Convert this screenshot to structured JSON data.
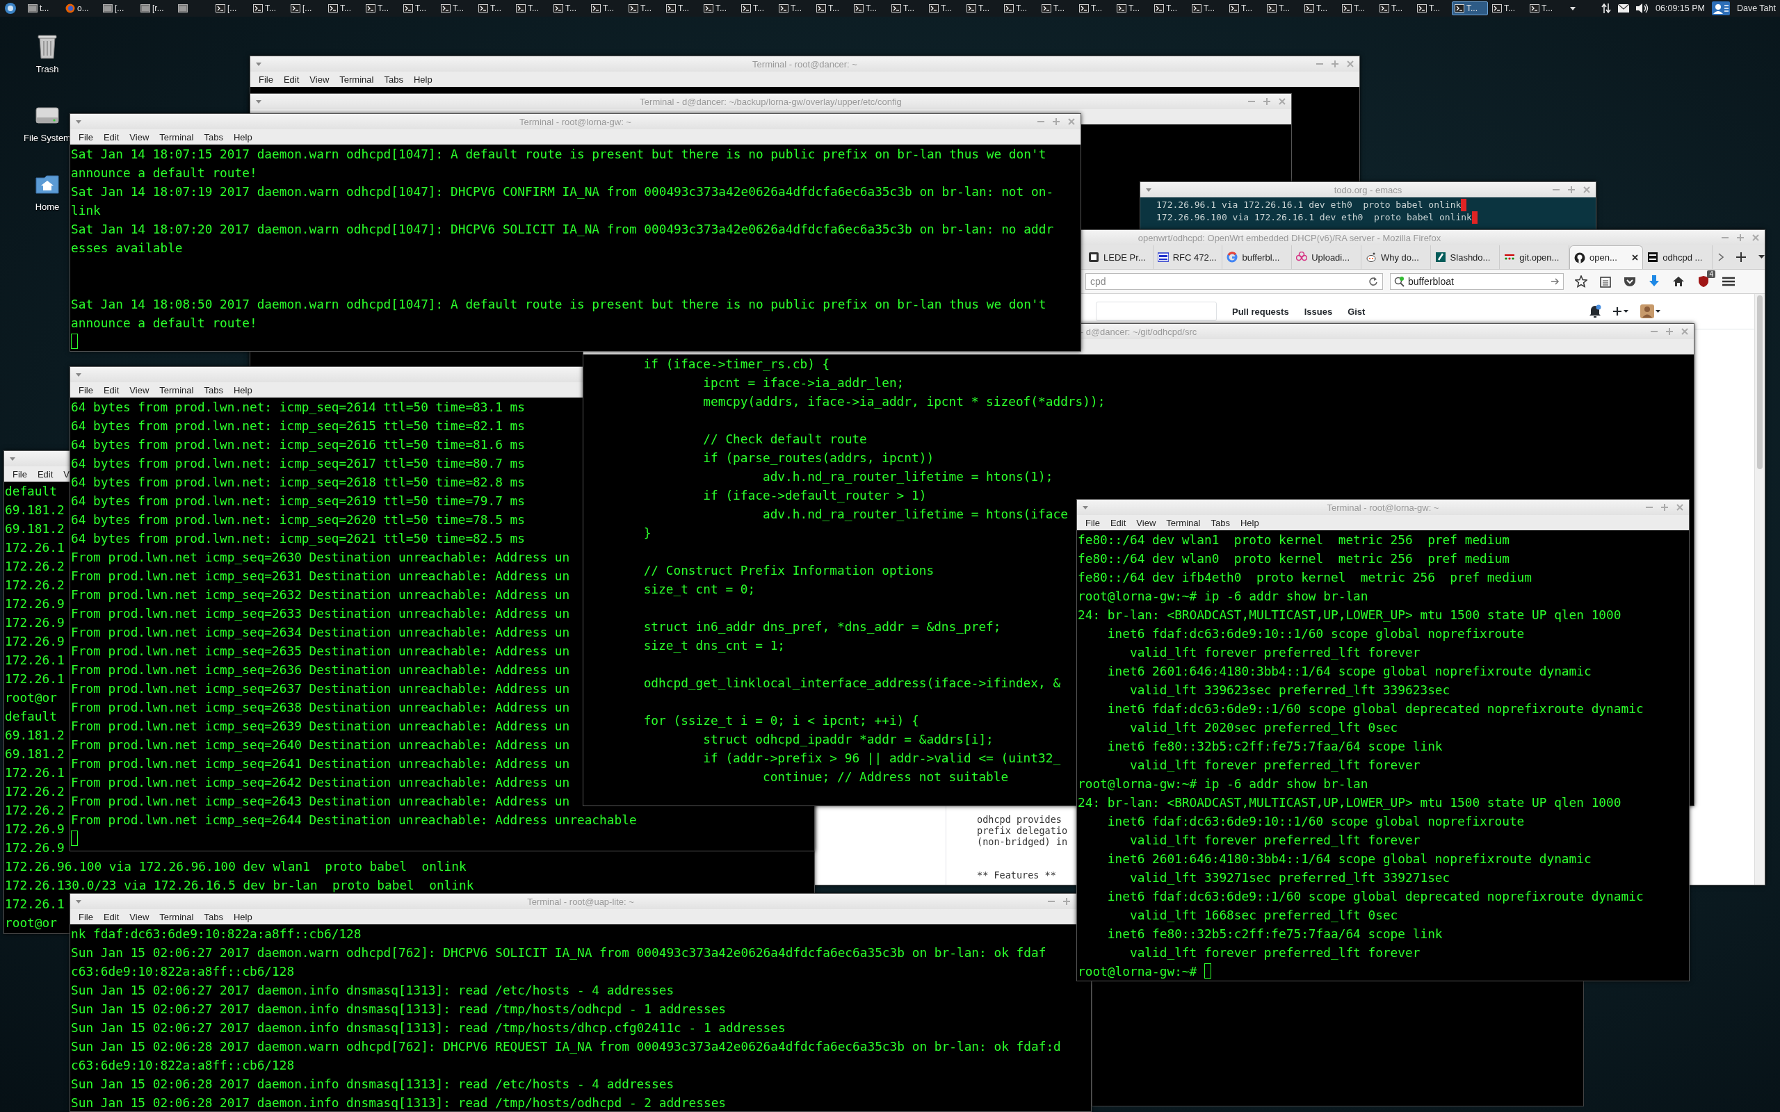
{
  "taskbar": {
    "items": [
      {
        "kind": "app",
        "label": "t...",
        "selected": false
      },
      {
        "kind": "browser",
        "label": "o...",
        "selected": false
      },
      {
        "kind": "app",
        "label": "[...",
        "selected": false
      },
      {
        "kind": "app",
        "label": "[r...",
        "selected": false
      },
      {
        "kind": "app",
        "selected": false
      },
      {
        "kind": "terminal",
        "label": "[...",
        "selected": false
      },
      {
        "kind": "terminal",
        "label": "T...",
        "selected": false
      },
      {
        "kind": "terminal",
        "label": "[...",
        "selected": false
      },
      {
        "kind": "terminal",
        "label": "T...",
        "selected": false
      },
      {
        "kind": "terminal",
        "label": "T...",
        "selected": false
      },
      {
        "kind": "terminal",
        "label": "T...",
        "selected": false
      },
      {
        "kind": "terminal",
        "label": "T...",
        "selected": false
      },
      {
        "kind": "terminal",
        "label": "T...",
        "selected": false
      },
      {
        "kind": "terminal",
        "label": "T...",
        "selected": false
      },
      {
        "kind": "terminal",
        "label": "T...",
        "selected": false
      },
      {
        "kind": "terminal",
        "label": "T...",
        "selected": false
      },
      {
        "kind": "terminal",
        "label": "T...",
        "selected": false
      },
      {
        "kind": "terminal",
        "label": "T...",
        "selected": false
      },
      {
        "kind": "terminal",
        "label": "T...",
        "selected": false
      },
      {
        "kind": "terminal",
        "label": "T...",
        "selected": false
      },
      {
        "kind": "terminal",
        "label": "T...",
        "selected": false
      },
      {
        "kind": "terminal",
        "label": "T...",
        "selected": false
      },
      {
        "kind": "terminal",
        "label": "T...",
        "selected": false
      },
      {
        "kind": "terminal",
        "label": "T...",
        "selected": false
      },
      {
        "kind": "terminal",
        "label": "T...",
        "selected": false
      },
      {
        "kind": "terminal",
        "label": "T...",
        "selected": false
      },
      {
        "kind": "terminal",
        "label": "T...",
        "selected": false
      },
      {
        "kind": "terminal",
        "label": "T...",
        "selected": false
      },
      {
        "kind": "terminal",
        "label": "T...",
        "selected": false
      },
      {
        "kind": "terminal",
        "label": "T...",
        "selected": false
      },
      {
        "kind": "terminal",
        "label": "T...",
        "selected": false
      },
      {
        "kind": "terminal",
        "label": "T...",
        "selected": false
      },
      {
        "kind": "terminal",
        "label": "T...",
        "selected": false
      },
      {
        "kind": "terminal",
        "label": "T...",
        "selected": false
      },
      {
        "kind": "terminal",
        "label": "T...",
        "selected": false
      },
      {
        "kind": "terminal",
        "label": "T...",
        "selected": false
      },
      {
        "kind": "terminal",
        "label": "T...",
        "selected": false
      },
      {
        "kind": "terminal",
        "label": "T...",
        "selected": false
      },
      {
        "kind": "terminal",
        "label": "T...",
        "selected": true
      },
      {
        "kind": "terminal",
        "label": "T...",
        "selected": false
      },
      {
        "kind": "terminal",
        "label": "T...",
        "selected": false
      }
    ],
    "clock": "06:09:15 PM",
    "user": "Dave Taht"
  },
  "desktop_icons": [
    {
      "label": "Trash"
    },
    {
      "label": "File System"
    },
    {
      "label": "Home"
    }
  ],
  "windows": [
    {
      "kind": "terminal",
      "title": "Terminal - root@dancer: ~",
      "menu": [
        "File",
        "Edit",
        "View",
        "Terminal",
        "Tabs",
        "Help"
      ]
    },
    {
      "kind": "terminal",
      "title": "Terminal - d@dancer: ~/backup/lorna-gw/overlay/upper/etc/config"
    },
    {
      "kind": "terminal",
      "title": "Terminal - root@lorna-gw: ~",
      "menu": [
        "File",
        "Edit",
        "View",
        "Terminal",
        "Tabs",
        "Help"
      ],
      "lines": [
        {
          "text": "Sat Jan 14 18:07:15 2017 daemon.warn odhcpd[1047]: A default route is present but there is no public prefix on br-lan thus we don't"
        },
        {
          "text": "announce a default route!"
        },
        {
          "text": "Sat Jan 14 18:07:19 2017 daemon.warn odhcpd[1047]: DHCPV6 CONFIRM IA_NA from 000493c373a42e0626a4dfdcfa6ec6a35c3b on br-lan: not on-"
        },
        {
          "text": "link"
        },
        {
          "text": "Sat Jan 14 18:07:20 2017 daemon.warn odhcpd[1047]: DHCPV6 SOLICIT IA_NA from 000493c373a42e0626a4dfdcfa6ec6a35c3b on br-lan: no addr"
        },
        {
          "text": "esses available"
        },
        {
          "kind": "blank"
        },
        {
          "kind": "blank"
        },
        {
          "text": "Sat Jan 14 18:08:50 2017 daemon.warn odhcpd[1047]: A default route is present but there is no public prefix on br-lan thus we don't"
        },
        {
          "text": "announce a default route!"
        },
        {
          "kind": "cursor"
        }
      ]
    },
    {
      "kind": "emacs",
      "title": "todo.org - emacs",
      "lines": [
        {
          "text": "172.26.96.1 via 172.26.16.1 dev eth0  proto babel onlink",
          "trailing_space": true
        },
        {
          "text": "172.26.96.100 via 172.26.16.1 dev eth0  proto babel onlink",
          "trailing_space": true
        }
      ]
    },
    {
      "kind": "browser",
      "title": "openwrt/odhcpd: OpenWrt embedded DHCP(v6)/RA server - Mozilla Firefox",
      "tabs": [
        {
          "label": "LEDE Pr...",
          "selected": false
        },
        {
          "label": "RFC 472...",
          "selected": false
        },
        {
          "label": "bufferbl...",
          "selected": false
        },
        {
          "label": "Uploadi...",
          "selected": false
        },
        {
          "label": "Why do...",
          "selected": false
        },
        {
          "label": "Slashdo...",
          "selected": false
        },
        {
          "label": "git.open...",
          "selected": false
        },
        {
          "label": "open...",
          "selected": true
        },
        {
          "label": "odhcpd ...",
          "selected": false
        }
      ],
      "address": "cpd",
      "search": "bufferbloat",
      "addon_badge": "4",
      "site_nav": [
        "Pull requests",
        "Issues",
        "Gist"
      ],
      "page_lines": [
        {
          "text": "odhcpd provides"
        },
        {
          "text": "prefix delegatio"
        },
        {
          "text": "(non-bridged) in"
        },
        {
          "kind": "section_heading",
          "text": "** Features **"
        }
      ]
    },
    {
      "kind": "terminal",
      "title": "- d@dancer: ~/git/odhcpd/src",
      "lines": [
        {
          "text": "        if (iface->timer_rs.cb) {"
        },
        {
          "text": "                ipcnt = iface->ia_addr_len;"
        },
        {
          "text": "                memcpy(addrs, iface->ia_addr, ipcnt * sizeof(*addrs));"
        },
        {
          "kind": "blank"
        },
        {
          "text": "                // Check default route"
        },
        {
          "text": "                if (parse_routes(addrs, ipcnt))"
        },
        {
          "text": "                        adv.h.nd_ra_router_lifetime = htons(1);"
        },
        {
          "text": "                if (iface->default_router > 1)"
        },
        {
          "text": "                        adv.h.nd_ra_router_lifetime = htons(iface"
        },
        {
          "text": "        }"
        },
        {
          "kind": "blank"
        },
        {
          "text": "        // Construct Prefix Information options"
        },
        {
          "text": "        size_t cnt = 0;"
        },
        {
          "kind": "blank"
        },
        {
          "text": "        struct in6_addr dns_pref, *dns_addr = &dns_pref;"
        },
        {
          "text": "        size_t dns_cnt = 1;"
        },
        {
          "kind": "blank"
        },
        {
          "text": "        odhcpd_get_linklocal_interface_address(iface->ifindex, &"
        },
        {
          "kind": "blank"
        },
        {
          "text": "        for (ssize_t i = 0; i < ipcnt; ++i) {"
        },
        {
          "text": "                struct odhcpd_ipaddr *addr = &addrs[i];"
        },
        {
          "text": "                if (addr->prefix > 96 || addr->valid <= (uint32_"
        },
        {
          "text": "                        continue; // Address not suitable"
        }
      ]
    },
    {
      "kind": "terminal",
      "menu": [
        "File",
        "Edit",
        "View",
        "Terminal",
        "Tabs",
        "Help"
      ],
      "lines": [
        {
          "text": "64 bytes from prod.lwn.net: icmp_seq=2614 ttl=50 time=83.1 ms"
        },
        {
          "text": "64 bytes from prod.lwn.net: icmp_seq=2615 ttl=50 time=82.1 ms"
        },
        {
          "text": "64 bytes from prod.lwn.net: icmp_seq=2616 ttl=50 time=81.6 ms"
        },
        {
          "text": "64 bytes from prod.lwn.net: icmp_seq=2617 ttl=50 time=80.7 ms"
        },
        {
          "text": "64 bytes from prod.lwn.net: icmp_seq=2618 ttl=50 time=82.8 ms"
        },
        {
          "text": "64 bytes from prod.lwn.net: icmp_seq=2619 ttl=50 time=79.7 ms"
        },
        {
          "text": "64 bytes from prod.lwn.net: icmp_seq=2620 ttl=50 time=78.5 ms"
        },
        {
          "text": "64 bytes from prod.lwn.net: icmp_seq=2621 ttl=50 time=82.5 ms"
        },
        {
          "text": "From prod.lwn.net icmp_seq=2630 Destination unreachable: Address un"
        },
        {
          "text": "From prod.lwn.net icmp_seq=2631 Destination unreachable: Address un"
        },
        {
          "text": "From prod.lwn.net icmp_seq=2632 Destination unreachable: Address un"
        },
        {
          "text": "From prod.lwn.net icmp_seq=2633 Destination unreachable: Address un"
        },
        {
          "text": "From prod.lwn.net icmp_seq=2634 Destination unreachable: Address un"
        },
        {
          "text": "From prod.lwn.net icmp_seq=2635 Destination unreachable: Address un"
        },
        {
          "text": "From prod.lwn.net icmp_seq=2636 Destination unreachable: Address un"
        },
        {
          "text": "From prod.lwn.net icmp_seq=2637 Destination unreachable: Address un"
        },
        {
          "text": "From prod.lwn.net icmp_seq=2638 Destination unreachable: Address un"
        },
        {
          "text": "From prod.lwn.net icmp_seq=2639 Destination unreachable: Address un"
        },
        {
          "text": "From prod.lwn.net icmp_seq=2640 Destination unreachable: Address un"
        },
        {
          "text": "From prod.lwn.net icmp_seq=2641 Destination unreachable: Address un"
        },
        {
          "text": "From prod.lwn.net icmp_seq=2642 Destination unreachable: Address un"
        },
        {
          "text": "From prod.lwn.net icmp_seq=2643 Destination unreachable: Address un"
        },
        {
          "text": "From prod.lwn.net icmp_seq=2644 Destination unreachable: Address unreachable"
        },
        {
          "kind": "cursor"
        }
      ]
    },
    {
      "kind": "terminal",
      "title": "Terminal - root@lorna-gw: ~",
      "menu": [
        "File",
        "Edit",
        "View",
        "Terminal",
        "Tabs",
        "Help"
      ],
      "lines": [
        {
          "text": "fe80::/64 dev wlan1  proto kernel  metric 256  pref medium"
        },
        {
          "text": "fe80::/64 dev wlan0  proto kernel  metric 256  pref medium"
        },
        {
          "text": "fe80::/64 dev ifb4eth0  proto kernel  metric 256  pref medium"
        },
        {
          "text": "root@lorna-gw:~# ip -6 addr show br-lan"
        },
        {
          "text": "24: br-lan: <BROADCAST,MULTICAST,UP,LOWER_UP> mtu 1500 state UP qlen 1000"
        },
        {
          "text": "    inet6 fdaf:dc63:6de9:10::1/60 scope global noprefixroute"
        },
        {
          "text": "       valid_lft forever preferred_lft forever"
        },
        {
          "text": "    inet6 2601:646:4180:3bb4::1/64 scope global noprefixroute dynamic"
        },
        {
          "text": "       valid_lft 339623sec preferred_lft 339623sec"
        },
        {
          "text": "    inet6 fdaf:dc63:6de9::1/60 scope global deprecated noprefixroute dynamic"
        },
        {
          "text": "       valid_lft 2020sec preferred_lft 0sec"
        },
        {
          "text": "    inet6 fe80::32b5:c2ff:fe75:7faa/64 scope link"
        },
        {
          "text": "       valid_lft forever preferred_lft forever"
        },
        {
          "text": "root@lorna-gw:~# ip -6 addr show br-lan"
        },
        {
          "text": "24: br-lan: <BROADCAST,MULTICAST,UP,LOWER_UP> mtu 1500 state UP qlen 1000"
        },
        {
          "text": "    inet6 fdaf:dc63:6de9:10::1/60 scope global noprefixroute"
        },
        {
          "text": "       valid_lft forever preferred_lft forever"
        },
        {
          "text": "    inet6 2601:646:4180:3bb4::1/64 scope global noprefixroute dynamic"
        },
        {
          "text": "       valid_lft 339271sec preferred_lft 339271sec"
        },
        {
          "text": "    inet6 fdaf:dc63:6de9::1/60 scope global deprecated noprefixroute dynamic"
        },
        {
          "text": "       valid_lft 1668sec preferred_lft 0sec"
        },
        {
          "text": "    inet6 fe80::32b5:c2ff:fe75:7faa/64 scope link"
        },
        {
          "text": "       valid_lft forever preferred_lft forever"
        },
        {
          "kind": "prompt",
          "text": "root@lorna-gw:~# "
        }
      ]
    },
    {
      "kind": "terminal",
      "menu": [
        "File",
        "Edit",
        "V"
      ],
      "lines": [
        {
          "text": "default"
        },
        {
          "text": "69.181.2"
        },
        {
          "text": "69.181.2"
        },
        {
          "text": "172.26.1"
        },
        {
          "text": "172.26.2"
        },
        {
          "text": "172.26.2"
        },
        {
          "text": "172.26.9"
        },
        {
          "text": "172.26.9"
        },
        {
          "text": "172.26.9"
        },
        {
          "text": "172.26.1"
        },
        {
          "text": "172.26.1"
        },
        {
          "text": "root@or"
        },
        {
          "text": "default"
        },
        {
          "text": "69.181.2"
        },
        {
          "text": "69.181.2"
        },
        {
          "text": "172.26.1"
        },
        {
          "text": "172.26.2"
        },
        {
          "text": "172.26.2"
        },
        {
          "text": "172.26.9"
        },
        {
          "text": "172.26.9"
        },
        {
          "text": "172.26.96.100 via 172.26.96.100 dev wlan1  proto babel  onlink"
        },
        {
          "text": "172.26.130.0/23 via 172.26.16.5 dev br-lan  proto babel  onlink"
        },
        {
          "text": "172.26.1"
        },
        {
          "text": "root@or"
        }
      ]
    },
    {
      "kind": "terminal",
      "title": "Terminal - root@uap-lite: ~",
      "menu": [
        "File",
        "Edit",
        "View",
        "Terminal",
        "Tabs",
        "Help"
      ],
      "lines": [
        {
          "text": "nk fdaf:dc63:6de9:10:822a:a8ff::cb6/128"
        },
        {
          "text": "Sun Jan 15 02:06:27 2017 daemon.warn odhcpd[762]: DHCPV6 SOLICIT IA_NA from 000493c373a42e0626a4dfdcfa6ec6a35c3b on br-lan: ok fdaf"
        },
        {
          "text": "c63:6de9:10:822a:a8ff::cb6/128"
        },
        {
          "text": "Sun Jan 15 02:06:27 2017 daemon.info dnsmasq[1313]: read /etc/hosts - 4 addresses"
        },
        {
          "text": "Sun Jan 15 02:06:27 2017 daemon.info dnsmasq[1313]: read /tmp/hosts/odhcpd - 1 addresses"
        },
        {
          "text": "Sun Jan 15 02:06:27 2017 daemon.info dnsmasq[1313]: read /tmp/hosts/dhcp.cfg02411c - 1 addresses"
        },
        {
          "text": "Sun Jan 15 02:06:28 2017 daemon.warn odhcpd[762]: DHCPV6 REQUEST IA_NA from 000493c373a42e0626a4dfdcfa6ec6a35c3b on br-lan: ok fdaf:d"
        },
        {
          "text": "c63:6de9:10:822a:a8ff::cb6/128"
        },
        {
          "text": "Sun Jan 15 02:06:28 2017 daemon.info dnsmasq[1313]: read /etc/hosts - 4 addresses"
        },
        {
          "text": "Sun Jan 15 02:06:28 2017 daemon.info dnsmasq[1313]: read /tmp/hosts/odhcpd - 2 addresses"
        }
      ]
    }
  ]
}
